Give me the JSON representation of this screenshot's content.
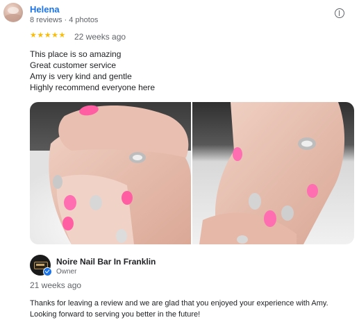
{
  "review": {
    "reviewer_name": "Helena",
    "reviewer_meta": "8 reviews · 4 photos",
    "stars": "★★★★★",
    "rating": 5,
    "time": "22 weeks ago",
    "text_lines": [
      "This place is so amazing",
      "Great customer service",
      "Amy is very kind and gentle",
      "Highly recommend everyone here"
    ],
    "more_icon": "more-info-icon"
  },
  "owner_reply": {
    "owner_name": "Noire Nail Bar In Franklin",
    "role": "Owner",
    "time": "21 weeks ago",
    "text_lines": [
      "Thanks for leaving a review and we are glad that you enjoyed your experience with Amy.",
      "Looking forward to serving you better in the future!"
    ],
    "verified_icon": "verified-check-icon"
  },
  "colors": {
    "link_blue": "#1a73e8",
    "star_yellow": "#fbbc04",
    "muted_text": "#5f6368"
  }
}
